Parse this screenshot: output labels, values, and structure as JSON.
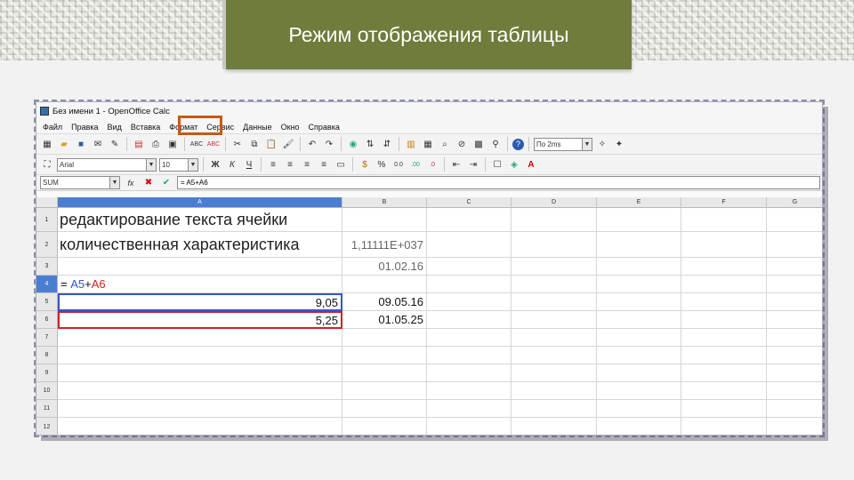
{
  "slide": {
    "title": "Режим отображения таблицы"
  },
  "window": {
    "title": "Без имени 1 - OpenOffice Calc",
    "menu": [
      "Файл",
      "Правка",
      "Вид",
      "Вставка",
      "Формат",
      "Сервис",
      "Данные",
      "Окно",
      "Справка"
    ],
    "font_name": "Arial",
    "font_size": "10",
    "extra_combo": "По 2ms",
    "name_box": "SUM",
    "formula": "= A5+A6"
  },
  "grid": {
    "columns": [
      "A",
      "B",
      "C",
      "D",
      "E",
      "F",
      "G"
    ],
    "rows": [
      "1",
      "2",
      "3",
      "4",
      "5",
      "6",
      "7",
      "8",
      "9",
      "10",
      "11",
      "12"
    ],
    "a1": "редактирование текста ячейки",
    "a2": "количественная характеристика",
    "b2": "1,11111E+037",
    "b3": "01.02.16",
    "a4_eq": "=",
    "a4_ref1": "A5",
    "a4_plus": "+",
    "a4_ref2": "A6",
    "a5": "9,05",
    "b5": "09.05.16",
    "a6": "5,25",
    "b6": "01.05.25"
  },
  "colors": {
    "title_bg": "#6e7c3c",
    "ref1": "#3355cc",
    "ref2": "#cc2222",
    "active_header": "#4a7ed1",
    "highlight": "#c55a11"
  }
}
